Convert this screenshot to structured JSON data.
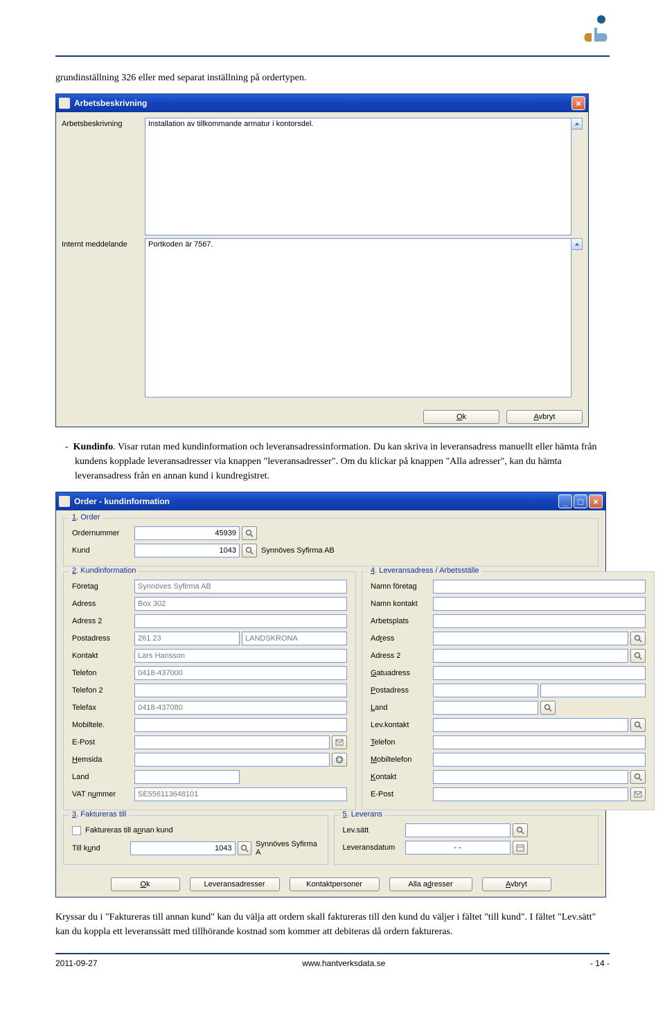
{
  "logo_colors": {
    "top": "#1b5a8e",
    "left": "#c98a2e",
    "right": "#7aa9c9"
  },
  "intro_text": "grundinställning 326 eller med separat inställning på ordertypen.",
  "win1": {
    "title": "Arbetsbeskrivning",
    "labels": {
      "arbetsbeskrivning": "Arbetsbeskrivning",
      "internt": "Internt meddelande"
    },
    "values": {
      "arbetsbeskrivning": "Installation av tillkommande armatur i kontorsdel.",
      "internt": "Portkoden är 7567."
    },
    "buttons": {
      "ok": "Ok",
      "avbryt": "Avbryt"
    }
  },
  "mid_text": {
    "bullet_label": "Kundinfo",
    "rest1": ". Visar rutan med kundinformation och leveransadressinformation. Du kan skriva in leveransadress manuellt eller hämta från kundens kopplade leveransadresser via knappen \"leveransadresser\". Om du klickar på knappen \"Alla adresser\", kan du hämta leveransadress från en annan kund i kundregistret."
  },
  "win2": {
    "title": "Order - kundinformation",
    "panel1": {
      "label": "1. Order",
      "ordernummer_lbl": "Ordernummer",
      "ordernummer": "45939",
      "kund_lbl": "Kund",
      "kund": "1043",
      "kund_name": "Synnöves Syfirma AB"
    },
    "panel2": {
      "label": "2. Kundinformation",
      "fields": {
        "foretag_lbl": "Företag",
        "foretag": "Synnöves Syfirma AB",
        "adress_lbl": "Adress",
        "adress": "Box 302",
        "adress2_lbl": "Adress 2",
        "adress2": "",
        "postadress_lbl": "Postadress",
        "postnr": "261 23",
        "postort": "LANDSKRONA",
        "kontakt_lbl": "Kontakt",
        "kontakt": "Lars Hansson",
        "telefon_lbl": "Telefon",
        "telefon": "0418-437000",
        "telefon2_lbl": "Telefon 2",
        "telefon2": "",
        "telefax_lbl": "Telefax",
        "telefax": "0418-437080",
        "mobil_lbl": "Mobiltele.",
        "mobil": "",
        "epost_lbl": "E-Post",
        "epost": "",
        "hemsida_lbl": "Hemsida",
        "hemsida": "",
        "land_lbl": "Land",
        "land": "",
        "vat_lbl": "VAT nummer",
        "vat": "SE556113648101"
      }
    },
    "panel4": {
      "label": "4. Leveransadress / Arbetsställe",
      "fields": {
        "namnforetag_lbl": "Namn företag",
        "namnkontakt_lbl": "Namn kontakt",
        "arbetsplats_lbl": "Arbetsplats",
        "adress_lbl": "Adress",
        "adress2_lbl": "Adress 2",
        "gatu_lbl": "Gatuadress",
        "post_lbl": "Postadress",
        "land_lbl": "Land",
        "levkontakt_lbl": "Lev.kontakt",
        "telefon_lbl": "Telefon",
        "mobil_lbl": "Mobiltelefon",
        "kontakt_lbl": "Kontakt",
        "epost_lbl": "E-Post"
      }
    },
    "panel3": {
      "label": "3. Faktureras till",
      "chk_lbl": "Faktureras till annan kund",
      "tillkund_lbl": "Till kund",
      "tillkund": "1043",
      "tillkund_name": "Synnöves Syfirma A"
    },
    "panel5": {
      "label": "5. Leverans",
      "levsatt_lbl": "Lev.sätt",
      "levsatt": "",
      "levdatum_lbl": "Leveransdatum",
      "levdatum": "- -"
    },
    "buttons": {
      "ok": "Ok",
      "leveransadresser": "Leveransadresser",
      "kontaktpersoner": "Kontaktpersoner",
      "allaadresser": "Alla adresser",
      "avbryt": "Avbryt"
    }
  },
  "after_text": "Kryssar du i \"Faktureras till annan kund\" kan du välja att ordern skall faktureras till den kund du väljer i fältet \"till kund\". I fältet \"Lev.sätt\" kan du koppla ett leveranssätt med tillhörande kostnad som kommer att debiteras då ordern faktureras.",
  "footer": {
    "left": "2011-09-27",
    "center": "www.hantverksdata.se",
    "right": "- 14 -"
  }
}
